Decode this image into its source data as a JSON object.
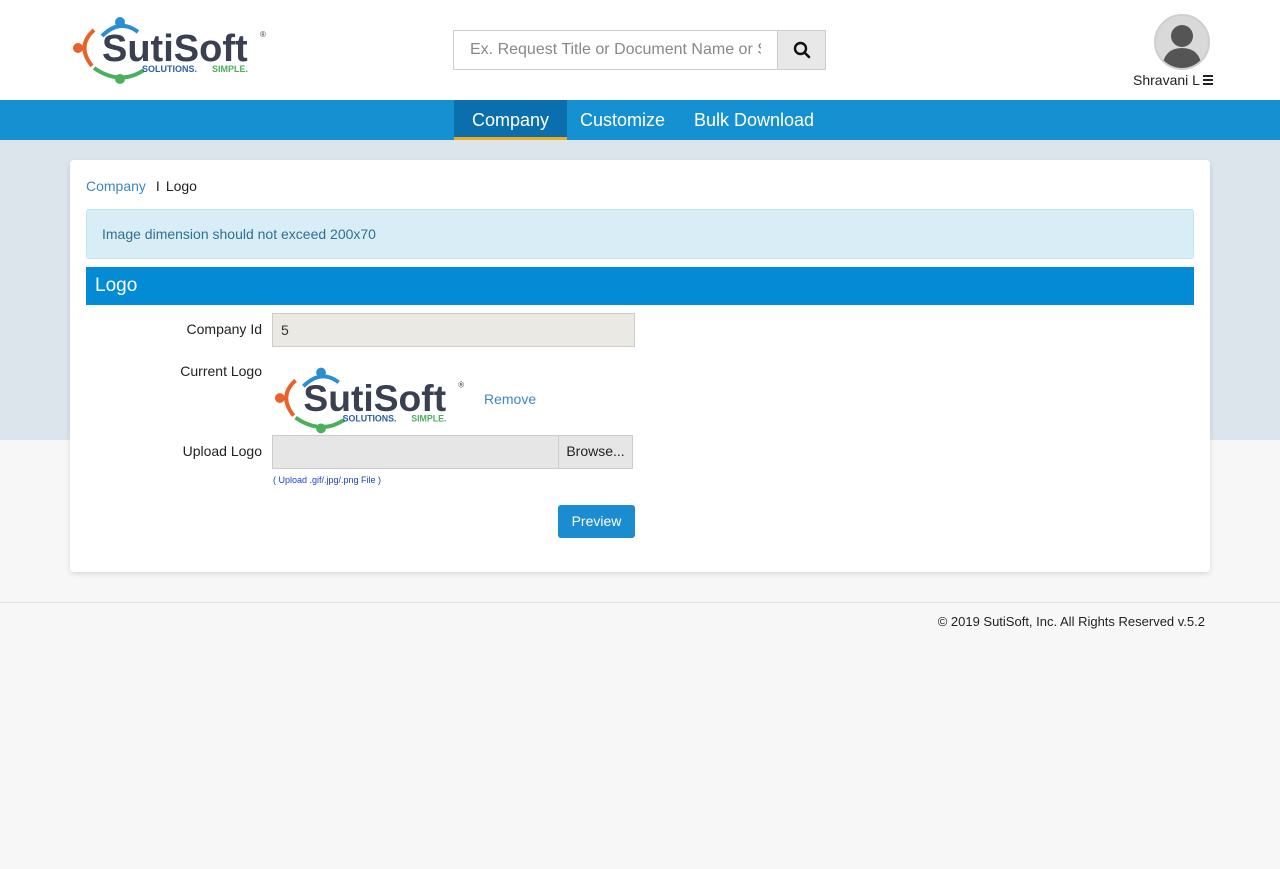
{
  "brand": {
    "name_prefix": "Suti",
    "name_suffix": "Soft",
    "tagline_a": "SOLUTIONS.",
    "tagline_b": "SIMPLE.",
    "registered": "®",
    "colors": {
      "orange": "#e8622a",
      "blue": "#2a8fd1",
      "green": "#4bb05b",
      "dark": "#3a3f52"
    }
  },
  "search": {
    "placeholder": "Ex. Request Title or Document Name or S",
    "button_icon": "search-icon"
  },
  "user": {
    "name": "Shravani L",
    "avatar_icon": "user-avatar-icon",
    "menu_icon": "hamburger-icon"
  },
  "nav": {
    "items": [
      {
        "label": "Company",
        "active": true
      },
      {
        "label": "Customize",
        "active": false
      },
      {
        "label": "Bulk Download",
        "active": false
      }
    ],
    "color": "#1590d0",
    "active_color": "#0b6fad",
    "active_underline": "#f0ad20"
  },
  "breadcrumb": {
    "parent": "Company",
    "separator": "I",
    "current": "Logo"
  },
  "alert": {
    "text": "Image dimension should not exceed 200x70"
  },
  "panel": {
    "title": "Logo"
  },
  "form": {
    "company_id_label": "Company Id",
    "company_id_value": "5",
    "current_logo_label": "Current Logo",
    "remove_label": "Remove",
    "upload_label": "Upload Logo",
    "browse_label": "Browse...",
    "upload_hint": "( Upload .gif/.jpg/.png File )",
    "preview_label": "Preview"
  },
  "footer": {
    "text": "© 2019 SutiSoft, Inc. All Rights Reserved v.5.2"
  }
}
